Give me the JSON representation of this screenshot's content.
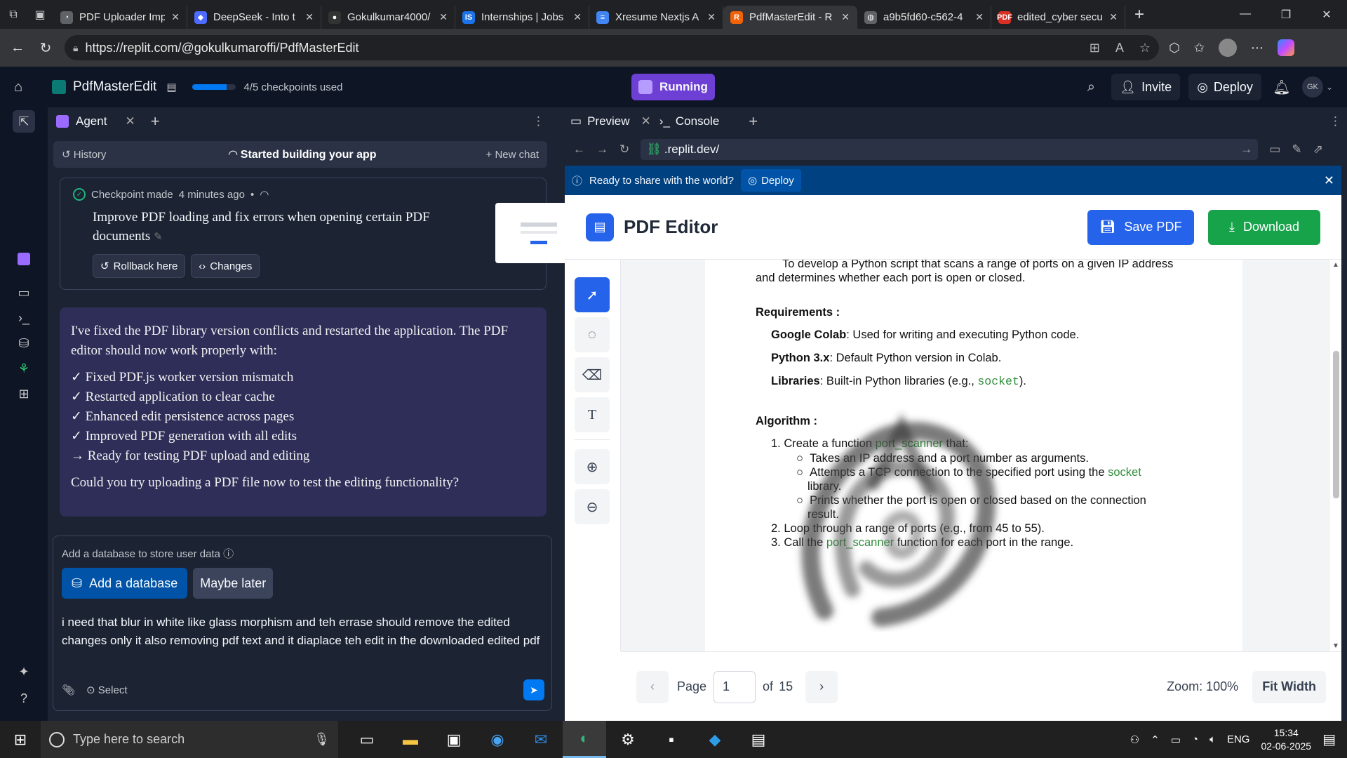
{
  "browser": {
    "tabs": [
      {
        "title": "PDF Uploader Imp",
        "color": "#5f6368",
        "glyph": "◔",
        "active": false
      },
      {
        "title": "DeepSeek - Into t",
        "color": "#4d6bfe",
        "glyph": "◆",
        "active": false
      },
      {
        "title": "Gokulkumar4000/",
        "color": "#333333",
        "glyph": "●",
        "active": false
      },
      {
        "title": "Internships | Jobs",
        "color": "#1a73e8",
        "glyph": "IS",
        "active": false
      },
      {
        "title": "Xresume Nextjs A",
        "color": "#4285f4",
        "glyph": "≡",
        "active": false
      },
      {
        "title": "PdfMasterEdit - R",
        "color": "#f26207",
        "glyph": "R",
        "active": true
      },
      {
        "title": "a9b5fd60-c562-4",
        "color": "#5f6368",
        "glyph": "◍",
        "active": false
      },
      {
        "title": "edited_cyber secu",
        "color": "#d93025",
        "glyph": "PDF",
        "active": false
      }
    ],
    "url": "https://replit.com/@gokulkumaroffi/PdfMasterEdit"
  },
  "replit": {
    "project_name": "PdfMasterEdit",
    "checkpoints_text": "4/5 checkpoints used",
    "checkpoints_fraction": 0.8,
    "running_label": "Running",
    "invite_label": "Invite",
    "deploy_label": "Deploy",
    "avatar_initials": "GK"
  },
  "agent": {
    "tab_label": "Agent",
    "history_label": "History",
    "status_label": "Started building your app",
    "new_chat_label": "New chat",
    "checkpoint": {
      "meta_prefix": "Checkpoint made",
      "meta_time": "4 minutes ago",
      "title": "Improve PDF loading and fix errors when opening certain PDF documents",
      "rollback_label": "Rollback here",
      "changes_label": "Changes"
    },
    "message": {
      "intro": "I've fixed the PDF library version conflicts and restarted the application. The PDF editor should now work properly with:",
      "items": [
        "✓ Fixed PDF.js worker version mismatch",
        "✓ Restarted application to clear cache",
        "✓ Enhanced edit persistence across pages",
        "✓ Improved PDF generation with all edits",
        "→ Ready for testing PDF upload and editing"
      ],
      "ask": "Could you try uploading a PDF file now to test the editing functionality?"
    },
    "database": {
      "prompt": "Add a database to store user data",
      "add_label": "Add a database",
      "later_label": "Maybe later"
    },
    "input_text": "i need that blur in white like glass morphism and teh errase should  remove the edited changes only it also removing pdf text and it diaplace teh edit in the downloaded edited pdf",
    "select_label": "Select"
  },
  "preview": {
    "tab_preview": "Preview",
    "tab_console": "Console",
    "url": ".replit.dev/",
    "banner_text": "Ready to share with the world?",
    "banner_deploy": "Deploy"
  },
  "app": {
    "title": "PDF Editor",
    "save_label": "Save PDF",
    "download_label": "Download",
    "page_label": "Page",
    "page_current": "1",
    "page_of": "of",
    "page_total": "15",
    "zoom_label": "Zoom: 100%",
    "fit_label": "Fit Width"
  },
  "pdf_page": {
    "line1": "To develop a Python script that scans a range of ports on a given IP address",
    "line2": "and determines whether each port is open or closed.",
    "req_heading": "Requirements :",
    "req1_bold": "Google Colab",
    "req1_rest": ": Used for writing and executing Python code.",
    "req2_bold": "Python 3.x",
    "req2_rest": ": Default Python version in Colab.",
    "req3_bold": "Libraries",
    "req3_rest": ": Built-in Python libraries (e.g., ",
    "req3_code": "socket",
    "req3_end": ").",
    "algo_heading": "Algorithm :",
    "step1_a": "1.  Create a function ",
    "step1_fn": "port_scanner",
    "step1_b": " that:",
    "sub1": "Takes an IP address and a port number as arguments.",
    "sub2_a": "Attempts a TCP connection to the specified port using the ",
    "sub2_lib": "socket",
    "sub2_b": "library.",
    "sub3_a": "Prints whether the port is open or closed based on the connection",
    "sub3_b": "result.",
    "step2": "2.  Loop through a range of ports (e.g., from 45 to 55).",
    "step3_a": "3.  Call the ",
    "step3_fn": "port_scanner",
    "step3_b": " function for each port in the range."
  },
  "taskbar": {
    "search_placeholder": "Type here to search",
    "lang": "ENG",
    "time": "15:34",
    "date": "02-06-2025"
  }
}
